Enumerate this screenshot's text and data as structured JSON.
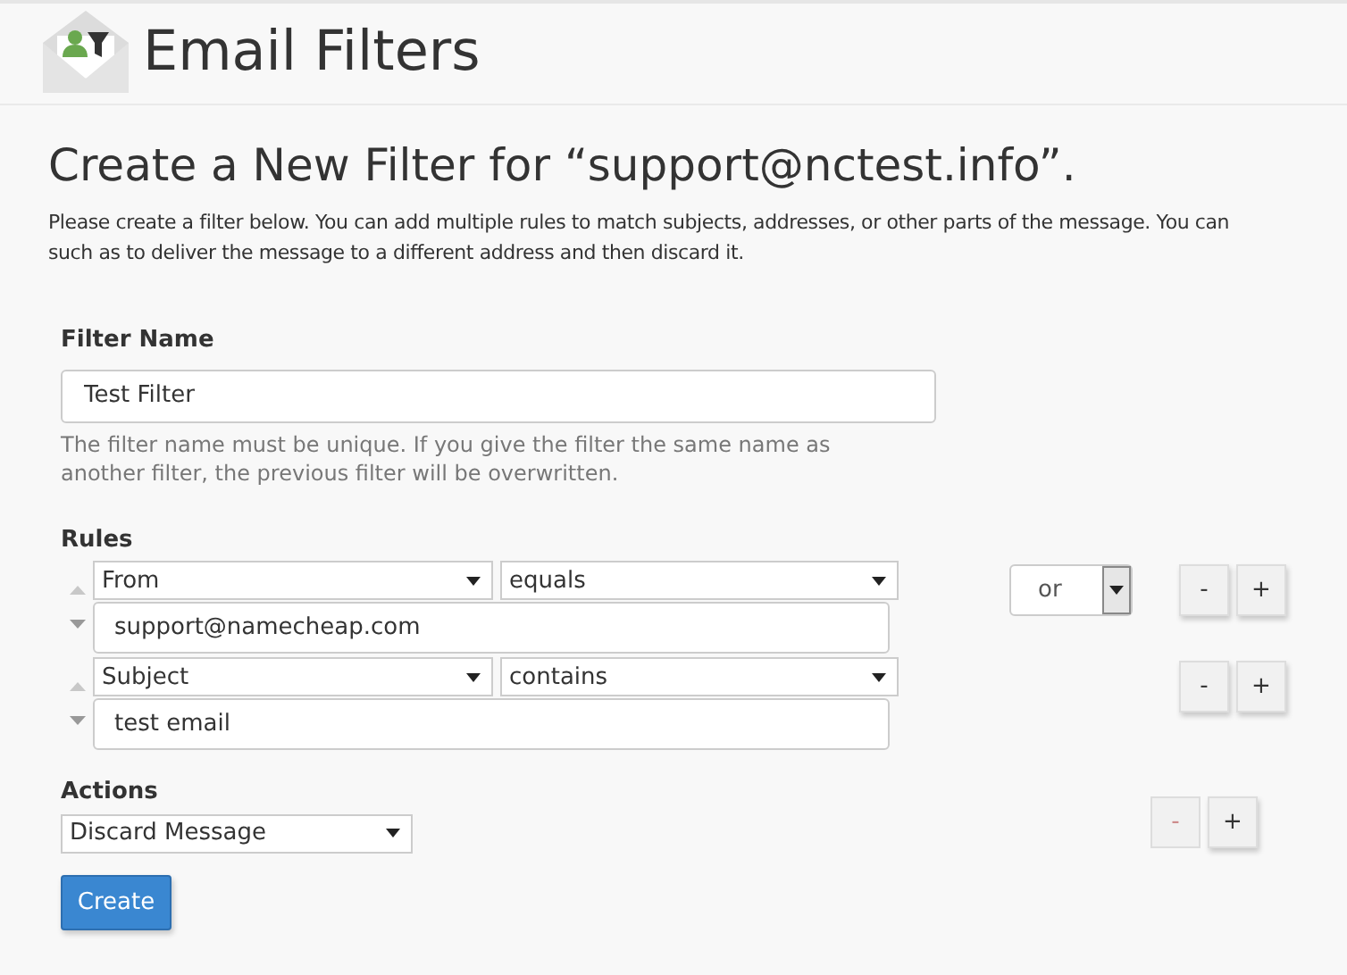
{
  "page": {
    "title": "Email Filters"
  },
  "heading": "Create a New Filter for “support@nctest.info”.",
  "description": [
    "Please create a filter below. You can add multiple rules to match subjects, addresses, or other parts of the message. You can",
    "such as to deliver the message to a different address and then discard it."
  ],
  "filter_name": {
    "label": "Filter Name",
    "value": "Test Filter",
    "help": "The filter name must be unique. If you give the filter the same name as another filter, the previous filter will be overwritten."
  },
  "rules": {
    "label": "Rules",
    "items": [
      {
        "field": "From",
        "operator": "equals",
        "value": "support@namecheap.com",
        "up_disabled": true,
        "down_disabled": false,
        "connector": "or",
        "remove": {
          "label": "-",
          "disabled": false
        },
        "add": "+"
      },
      {
        "field": "Subject",
        "operator": "contains",
        "value": "test email",
        "up_disabled": true,
        "down_disabled": false,
        "remove": {
          "label": "-",
          "disabled": false
        },
        "add": "+"
      }
    ]
  },
  "actions": {
    "label": "Actions",
    "items": [
      {
        "action": "Discard Message",
        "remove": {
          "label": "-",
          "disabled": true
        },
        "add": "+"
      }
    ]
  },
  "submit": "Create"
}
